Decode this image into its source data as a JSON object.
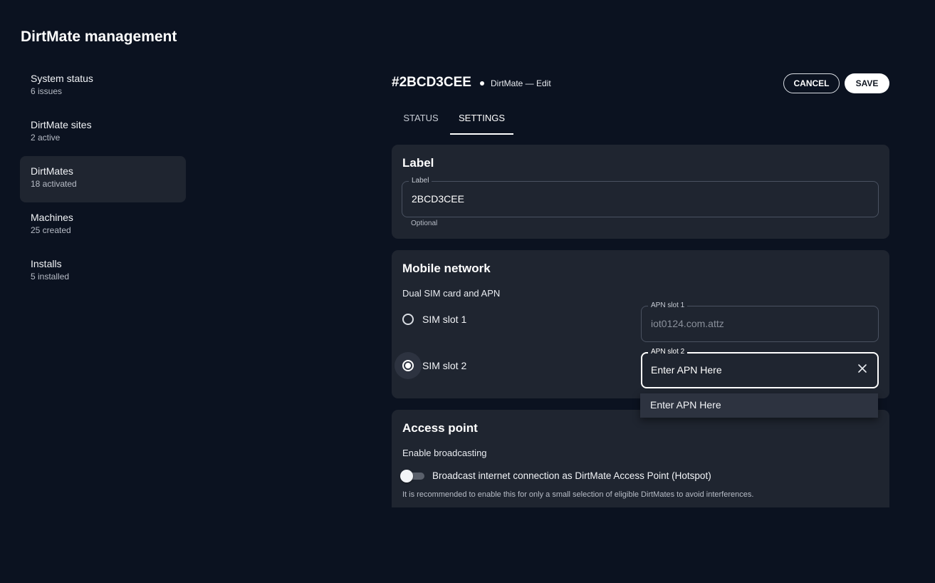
{
  "app": {
    "title": "DirtMate management"
  },
  "sidebar": {
    "items": [
      {
        "label": "System status",
        "sub": "6 issues"
      },
      {
        "label": "DirtMate sites",
        "sub": "2 active"
      },
      {
        "label": "DirtMates",
        "sub": "18 activated"
      },
      {
        "label": "Machines",
        "sub": "25 created"
      },
      {
        "label": "Installs",
        "sub": "5 installed"
      }
    ],
    "active": "DirtMates"
  },
  "header": {
    "device_id": "#2BCD3CEE",
    "breadcrumb": "DirtMate — Edit",
    "cancel_label": "CANCEL",
    "save_label": "SAVE"
  },
  "tabs": [
    {
      "label": "STATUS"
    },
    {
      "label": "SETTINGS"
    }
  ],
  "active_tab": "SETTINGS",
  "label_card": {
    "title": "Label",
    "field_legend": "Label",
    "field_value": "2BCD3CEE",
    "helper": "Optional"
  },
  "mobile_network": {
    "title": "Mobile network",
    "subtitle": "Dual SIM card and APN",
    "slots": [
      {
        "radio_label": "SIM slot 1",
        "checked": false,
        "apn_legend": "APN slot 1",
        "apn_value": "iot0124.com.attz",
        "disabled": true
      },
      {
        "radio_label": "SIM slot 2",
        "checked": true,
        "apn_legend": "APN slot 2",
        "apn_value": "Enter APN Here",
        "disabled": false
      }
    ],
    "suggestion": "Enter APN Here"
  },
  "access_point": {
    "title": "Access point",
    "subtitle": "Enable broadcasting",
    "toggle_label": "Broadcast internet connection as DirtMate Access Point (Hotspot)",
    "toggle_on": false,
    "hint": "It is recommended to enable this for only a small selection of eligible DirtMates to avoid interferences."
  },
  "colors": {
    "background": "#0b1220",
    "card": "#1f2530",
    "text": "#ffffff"
  }
}
